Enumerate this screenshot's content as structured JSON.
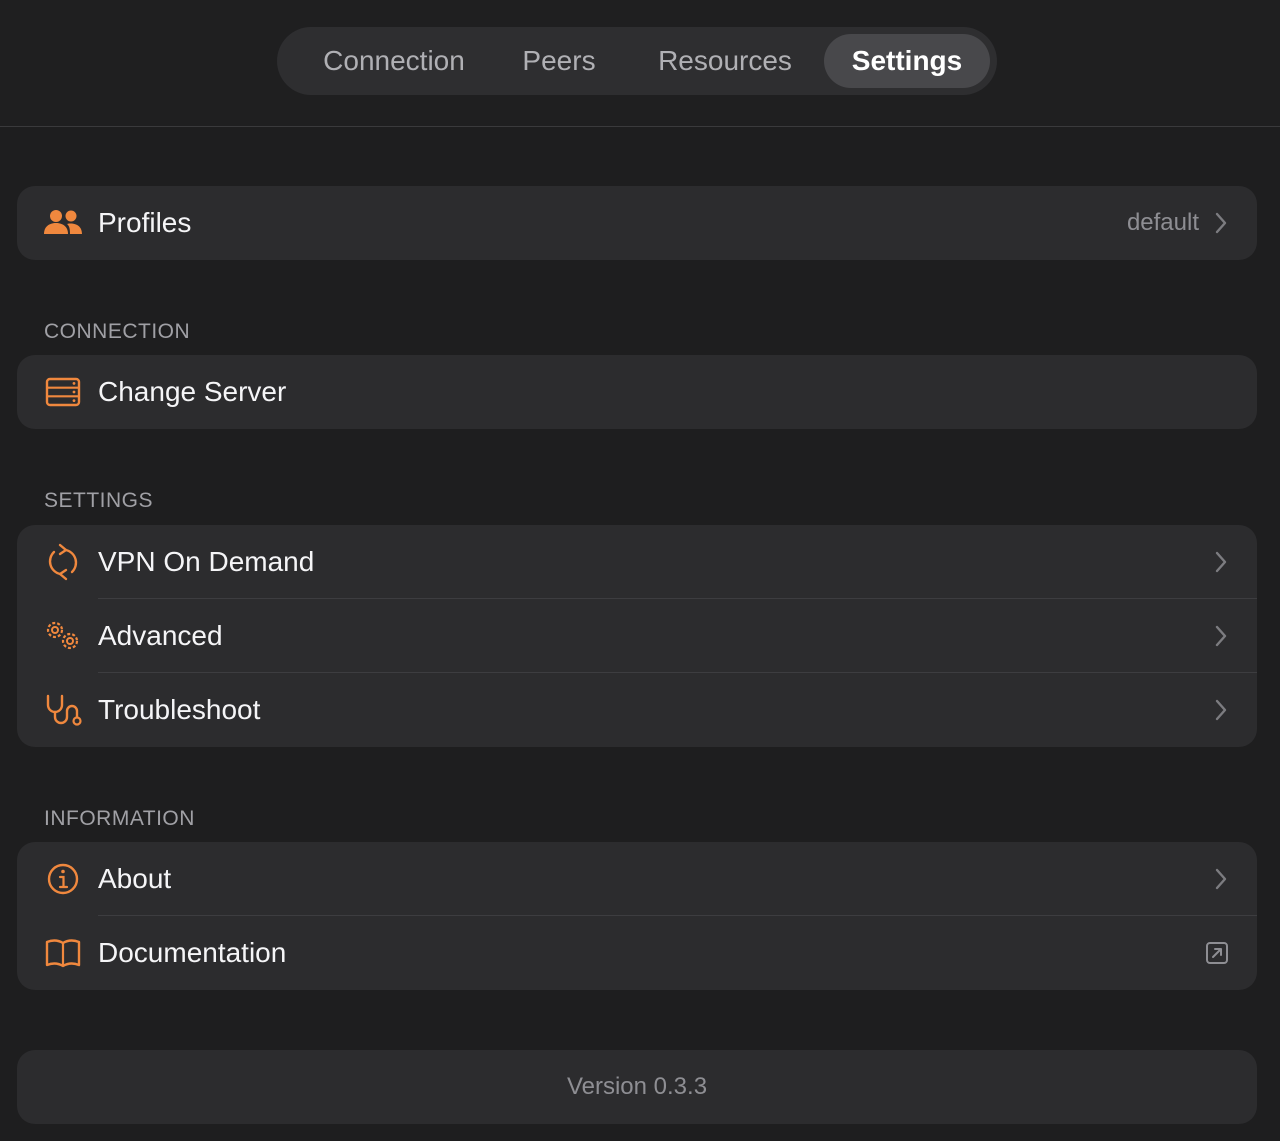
{
  "tabs": [
    {
      "label": "Connection",
      "active": false
    },
    {
      "label": "Peers",
      "active": false
    },
    {
      "label": "Resources",
      "active": false
    },
    {
      "label": "Settings",
      "active": true
    }
  ],
  "profiles": {
    "label": "Profiles",
    "value": "default",
    "icon": "people-icon"
  },
  "sections": {
    "connection": {
      "title": "CONNECTION",
      "items": [
        {
          "label": "Change Server",
          "icon": "server-icon"
        }
      ]
    },
    "settings": {
      "title": "SETTINGS",
      "items": [
        {
          "label": "VPN On Demand",
          "icon": "refresh-icon"
        },
        {
          "label": "Advanced",
          "icon": "gears-icon"
        },
        {
          "label": "Troubleshoot",
          "icon": "stethoscope-icon"
        }
      ]
    },
    "information": {
      "title": "INFORMATION",
      "items": [
        {
          "label": "About",
          "icon": "info-icon"
        },
        {
          "label": "Documentation",
          "icon": "book-icon"
        }
      ]
    }
  },
  "version": "Version 0.3.3",
  "colors": {
    "accent": "#f0883e",
    "background": "#1e1e1f",
    "card": "#2c2c2e"
  }
}
